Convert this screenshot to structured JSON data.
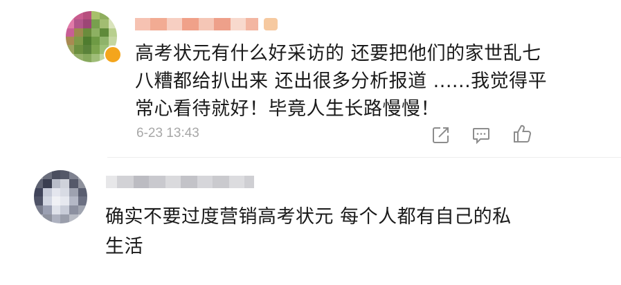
{
  "comments": [
    {
      "nickname": "",
      "text": "高考状元有什么好采访的 还要把他们的家世乱七\n八糟都给扒出来 还出很多分析报道 ......我觉得平\n常心看待就好！毕竟人生长路慢慢！",
      "time": "6-23 13:43",
      "actions": [
        "share-icon",
        "reply-icon",
        "like-icon"
      ]
    },
    {
      "nickname": "",
      "text": "确实不要过度营销高考状元 每个人都有自己的私\n生活"
    }
  ],
  "colors": {
    "text": "#1a1a1a",
    "meta": "#a7a7a7",
    "icon": "#8c8c8c",
    "badge": "#f4a51c"
  }
}
